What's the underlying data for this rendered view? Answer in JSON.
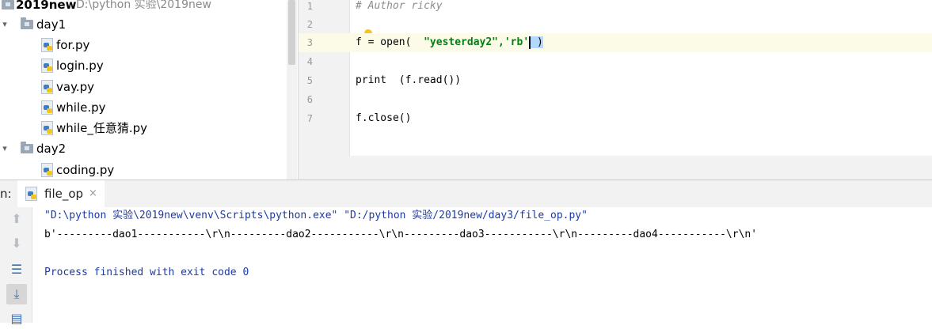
{
  "project": {
    "root": {
      "name": "2019new",
      "path": "D:\\python 实验\\2019new"
    },
    "folders": [
      {
        "name": "day1",
        "expanded": true,
        "files": [
          "for.py",
          "login.py",
          "vay.py",
          "while.py",
          "while_任意猜.py"
        ]
      },
      {
        "name": "day2",
        "expanded": true,
        "files": [
          "coding.py"
        ]
      }
    ]
  },
  "editor": {
    "current_line": 3,
    "lines": [
      {
        "num": "1",
        "text": "# Author ricky"
      },
      {
        "num": "2",
        "text": ""
      },
      {
        "num": "3",
        "pre": "f = open(  ",
        "str": "\"yesterday2\",'rb'",
        "post": " )"
      },
      {
        "num": "4",
        "text": ""
      },
      {
        "num": "5",
        "text": "print  (f.read())"
      },
      {
        "num": "6",
        "text": ""
      },
      {
        "num": "7",
        "text": "f.close()"
      }
    ]
  },
  "run": {
    "prefix": "n:",
    "tab_label": "file_op",
    "tab_close": "×",
    "toolbar": [
      {
        "icon": "arrow-up-icon",
        "glyph": "⬆"
      },
      {
        "icon": "arrow-down-icon",
        "glyph": "⬇"
      },
      {
        "icon": "soft-wrap-icon",
        "glyph": "☰"
      },
      {
        "icon": "scroll-to-end-icon",
        "glyph": "⤓"
      },
      {
        "icon": "print-icon",
        "glyph": "▤"
      }
    ],
    "console": [
      "\"D:\\python 实验\\2019new\\venv\\Scripts\\python.exe\" \"D:/python 实验/2019new/day3/file_op.py\"",
      "b'---------dao1-----------\\r\\n---------dao2-----------\\r\\n---------dao3-----------\\r\\n---------dao4-----------\\r\\n'",
      "",
      "Process finished with exit code 0"
    ]
  }
}
